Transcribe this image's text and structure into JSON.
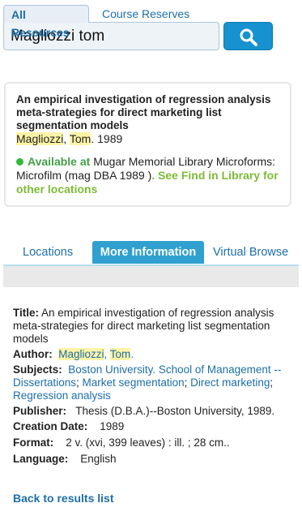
{
  "search": {
    "tab_all": "All Resources",
    "tab_reserves": "Course Reserves",
    "query": "Magliozzi tom"
  },
  "record": {
    "title": "An empirical investigation of regression analysis meta-strategies for direct marketing list segmentation models",
    "author_last": "Magliozzi",
    "author_first": "Tom",
    "year": "1989",
    "availability_status": "Available at",
    "location": "Mugar Memorial Library Microforms: Microfilm  (mag DBA 1989 )",
    "see_find_link": ". See Find in Library for other locations"
  },
  "tabs": [
    "Locations",
    "More Information",
    "Virtual Browse"
  ],
  "details": {
    "title_label": "Title:",
    "title_value": "An empirical investigation of regression analysis meta-strategies for direct marketing list segmentation models",
    "author_label": "Author:",
    "author_last": "Magliozzi",
    "author_first": "Tom",
    "subjects_label": "Subjects:",
    "subjects": [
      "Boston University. School of Management -- Dissertations",
      "Market segmentation",
      "Direct marketing",
      "Regression analysis"
    ],
    "publisher_label": "Publisher:",
    "publisher_value": "Thesis (D.B.A.)--Boston University, 1989.",
    "creation_label": "Creation Date:",
    "creation_value": "1989",
    "format_label": "Format:",
    "format_value": "2 v. (xvi, 399 leaves) : ill. ; 28 cm..",
    "language_label": "Language:",
    "language_value": "English"
  },
  "back_link": "Back to results list",
  "colors": {
    "accent": "#2fa0cf",
    "link": "#1d6fa8",
    "available": "#32b83a",
    "highlight": "#fdf3a6"
  },
  "icons": {
    "search_button": "magnifier-icon",
    "availability": "green-dot-icon"
  }
}
